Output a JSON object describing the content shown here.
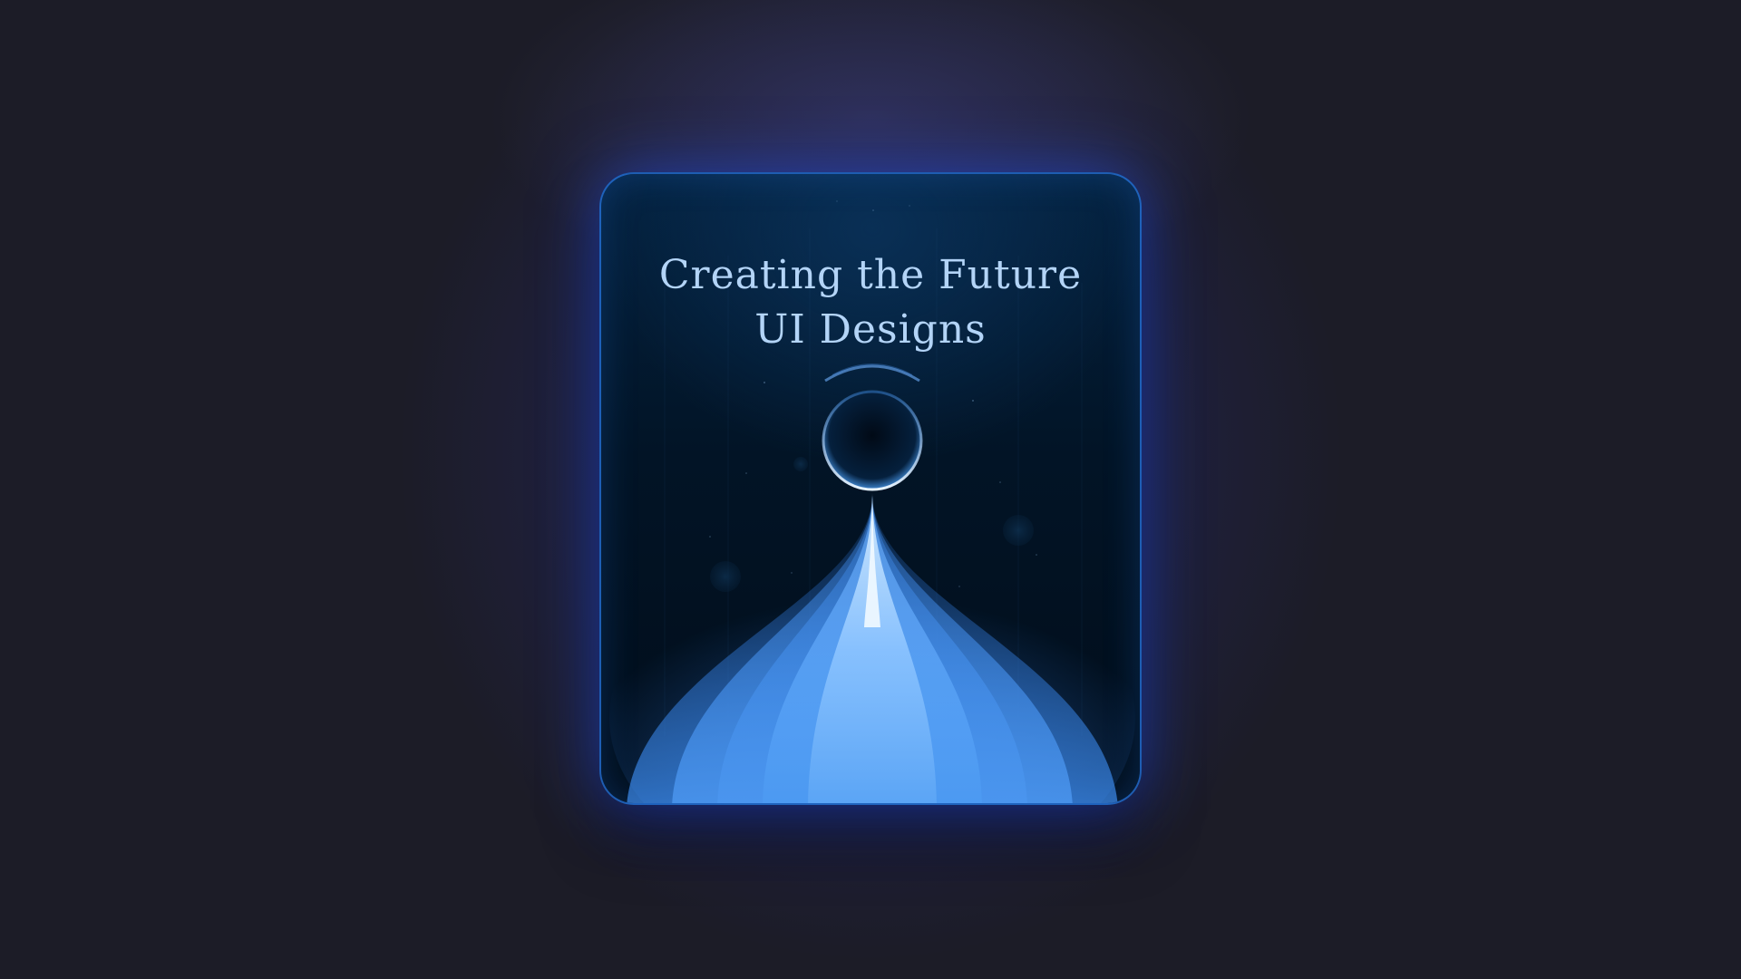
{
  "card": {
    "title_line1": "Creating the Future",
    "title_line2": "UI Designs"
  },
  "colors": {
    "background": "#1c1c27",
    "glow": "#3440d2",
    "card_border": "#2878e6",
    "title_text": "#b3d4f7",
    "beam": "#4aa0ff"
  },
  "icons": {
    "orb": "orb-icon",
    "beam": "light-beam-icon"
  }
}
